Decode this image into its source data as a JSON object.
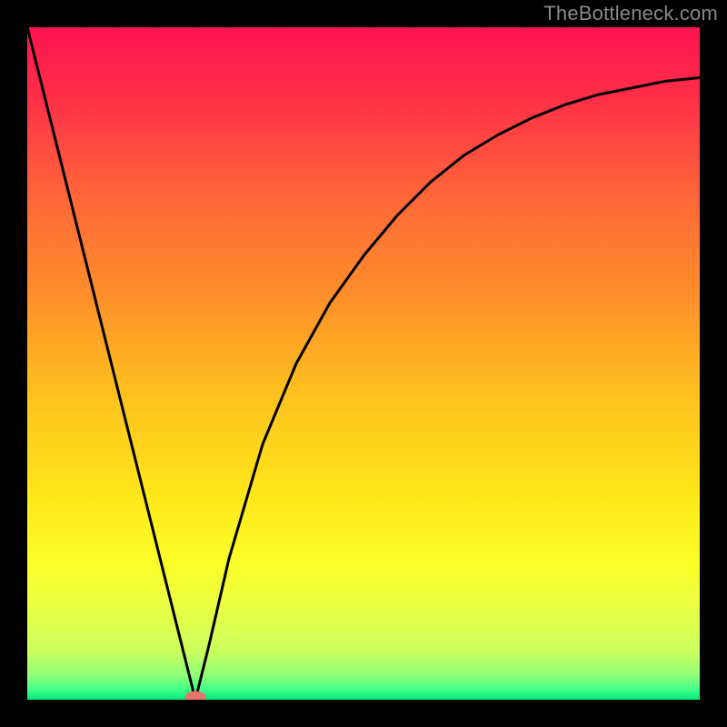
{
  "attribution": "TheBottleneck.com",
  "chart_data": {
    "type": "line",
    "title": "",
    "xlabel": "",
    "ylabel": "",
    "xlim": [
      0,
      100
    ],
    "ylim": [
      0,
      100
    ],
    "minimum_x": 25,
    "series": [
      {
        "name": "bottleneck-curve",
        "x": [
          0,
          5,
          10,
          15,
          20,
          23,
          25,
          27,
          30,
          35,
          40,
          45,
          50,
          55,
          60,
          65,
          70,
          75,
          80,
          85,
          90,
          95,
          100
        ],
        "y": [
          100,
          80,
          60,
          40,
          20,
          8,
          0,
          8,
          21,
          38,
          50,
          59,
          66,
          72,
          77,
          81,
          84,
          86.5,
          88.5,
          90,
          91,
          92,
          92.5
        ]
      }
    ],
    "gradient_stops": [
      {
        "offset": 0.0,
        "color": "#ff1450"
      },
      {
        "offset": 0.1,
        "color": "#ff2d48"
      },
      {
        "offset": 0.25,
        "color": "#ff6638"
      },
      {
        "offset": 0.4,
        "color": "#ff8f2a"
      },
      {
        "offset": 0.55,
        "color": "#ffc21e"
      },
      {
        "offset": 0.7,
        "color": "#ffe81a"
      },
      {
        "offset": 0.8,
        "color": "#fbff2a"
      },
      {
        "offset": 0.88,
        "color": "#e3ff4a"
      },
      {
        "offset": 0.93,
        "color": "#c8ff5e"
      },
      {
        "offset": 0.965,
        "color": "#8cff78"
      },
      {
        "offset": 0.985,
        "color": "#40ff88"
      },
      {
        "offset": 1.0,
        "color": "#00e879"
      }
    ],
    "marker_color": "#e97468"
  }
}
